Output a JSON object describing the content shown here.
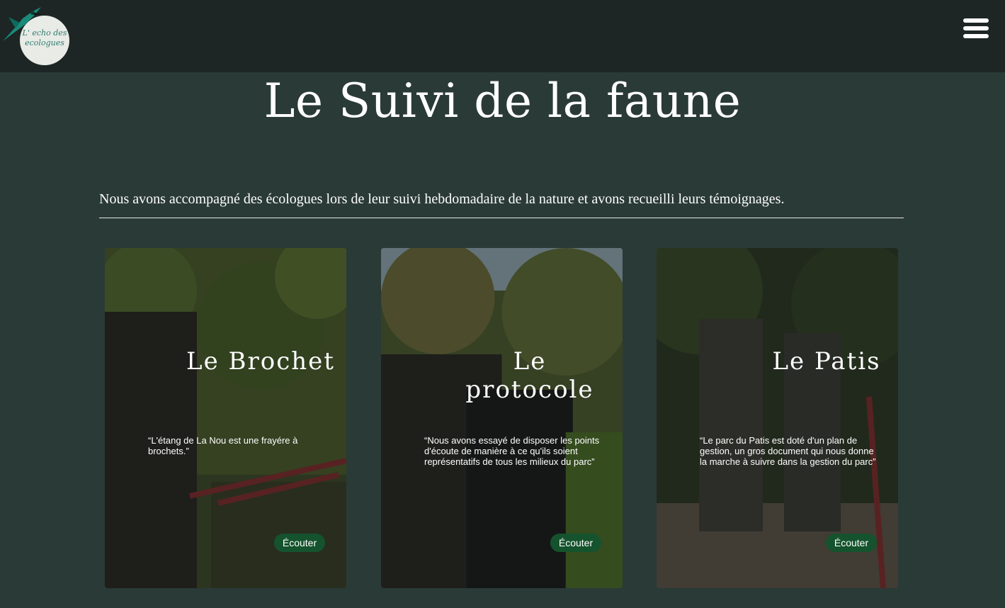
{
  "brand": {
    "logo_text_line1": "L' echo des",
    "logo_text_line2": "ecologues"
  },
  "header": {
    "menu_icon": "hamburger-menu-icon"
  },
  "page": {
    "title": "Le Suivi de la faune",
    "intro": "Nous avons accompagné des écologues lors de leur suivi hebdomadaire de la nature et avons recueilli leurs témoignages."
  },
  "cards": [
    {
      "title": "Le Brochet",
      "quote": "“L'étang de La Nou est une frayére à brochets.”",
      "button": "Écouter"
    },
    {
      "title": "Le protocole",
      "quote": "“Nous avons essayé de disposer les points d'écoute de manière à ce qu'ils soient représentatifs de tous les milieux du parc”",
      "button": "Écouter"
    },
    {
      "title": "Le Patis",
      "quote": "“Le parc du Patis est doté d'un plan de gestion, un gros document qui nous donne la marche à suivre dans la gestion du parc”",
      "button": "Écouter"
    }
  ],
  "colors": {
    "background": "#2a3a37",
    "topbar": "#1d2624",
    "button": "#14532d",
    "text": "#ffffff"
  }
}
